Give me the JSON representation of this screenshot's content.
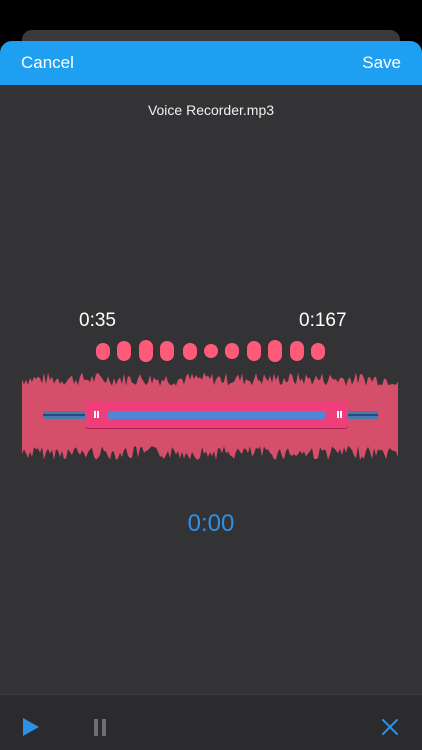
{
  "navbar": {
    "cancel_label": "Cancel",
    "save_label": "Save",
    "color": "#1e9ff2"
  },
  "file": {
    "name": "Voice Recorder.mp3"
  },
  "trim": {
    "start_label": "0:35",
    "end_label": "0:167"
  },
  "playback": {
    "current_time": "0:00"
  },
  "colors": {
    "waveform": "#d64f6a",
    "selection": "#ef3f7a",
    "accent_blue": "#2d8fe6"
  },
  "icons": {
    "play": "play-icon",
    "pause": "pause-icon",
    "close": "close-icon"
  }
}
